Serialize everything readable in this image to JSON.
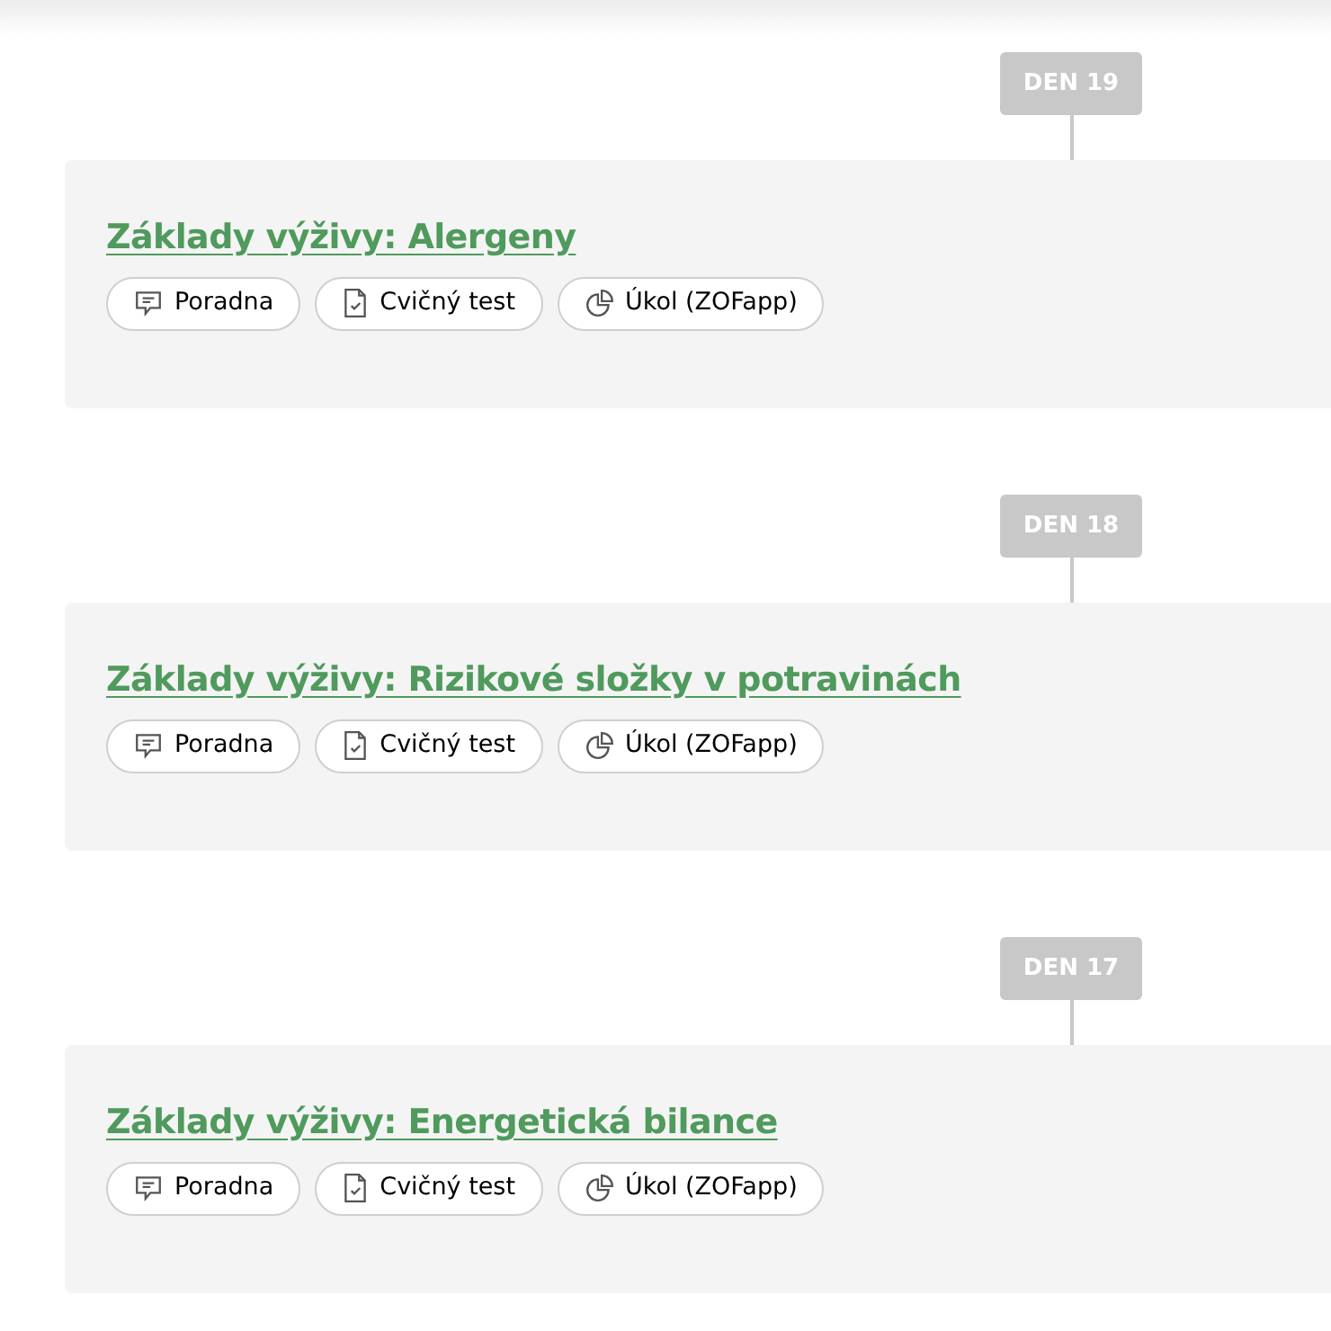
{
  "lessons": [
    {
      "day": "DEN 19",
      "title": "Základy výživy: Alergeny",
      "links": [
        {
          "kind": "chat",
          "label": "Poradna"
        },
        {
          "kind": "test",
          "label": "Cvičný test"
        },
        {
          "kind": "task",
          "label": "Úkol (ZOFapp)"
        }
      ]
    },
    {
      "day": "DEN 18",
      "title": "Základy výživy: Rizikové složky v potravinách",
      "links": [
        {
          "kind": "chat",
          "label": "Poradna"
        },
        {
          "kind": "test",
          "label": "Cvičný test"
        },
        {
          "kind": "task",
          "label": "Úkol (ZOFapp)"
        }
      ]
    },
    {
      "day": "DEN 17",
      "title": "Základy výživy: Energetická bilance",
      "links": [
        {
          "kind": "chat",
          "label": "Poradna"
        },
        {
          "kind": "test",
          "label": "Cvičný test"
        },
        {
          "kind": "task",
          "label": "Úkol (ZOFapp)"
        }
      ]
    }
  ]
}
